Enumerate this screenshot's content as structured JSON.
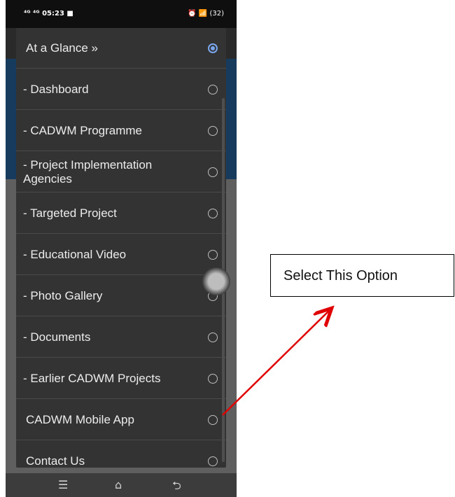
{
  "status_bar": {
    "left_text": "⁴ᴳ ⁴ᴳ 05:23 ■",
    "right_text": "⏰ 📶 (32)"
  },
  "menu": {
    "items": [
      {
        "label": "At a Glance »",
        "selected": true
      },
      {
        "label": "- Dashboard",
        "selected": false
      },
      {
        "label": "- CADWM Programme",
        "selected": false
      },
      {
        "label": "- Project Implementation Agencies",
        "selected": false
      },
      {
        "label": "- Targeted Project",
        "selected": false
      },
      {
        "label": "- Educational Video",
        "selected": false
      },
      {
        "label": "- Photo Gallery",
        "selected": false
      },
      {
        "label": "- Documents",
        "selected": false
      },
      {
        "label": "- Earlier CADWM Projects",
        "selected": false
      },
      {
        "label": "CADWM Mobile App",
        "selected": false
      },
      {
        "label": "Contact Us",
        "selected": false
      }
    ]
  },
  "nav_bar": {
    "menu_glyph": "☰",
    "home_glyph": "⌂",
    "back_glyph": "⮌"
  },
  "annotation": {
    "callout_text": "Select This Option",
    "arrow_color": "#e00000"
  },
  "colors": {
    "menu_bg": "#333333",
    "accent": "#7aa7ef",
    "header_blue": "#163b5c"
  }
}
